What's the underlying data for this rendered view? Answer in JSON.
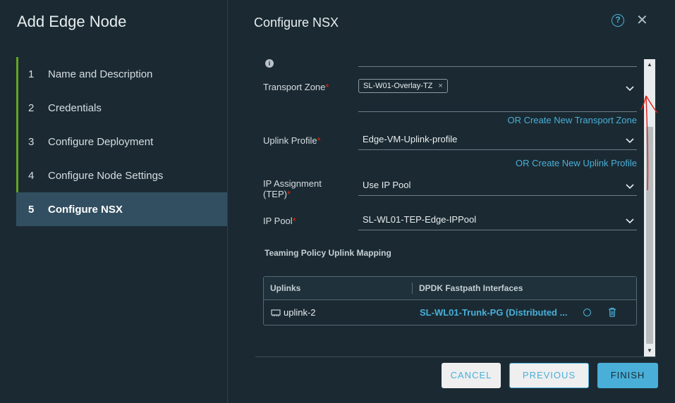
{
  "wizard": {
    "title": "Add Edge Node",
    "steps": [
      {
        "num": "1",
        "label": "Name and Description"
      },
      {
        "num": "2",
        "label": "Credentials"
      },
      {
        "num": "3",
        "label": "Configure Deployment"
      },
      {
        "num": "4",
        "label": "Configure Node Settings"
      },
      {
        "num": "5",
        "label": "Configure NSX"
      }
    ]
  },
  "page": {
    "title": "Configure NSX",
    "help_glyph": "?",
    "close_glyph": "✕"
  },
  "form": {
    "transport_zone": {
      "label": "Transport Zone",
      "chip": "SL-W01-Overlay-TZ",
      "chip_remove": "×",
      "create_link": "OR Create New Transport Zone"
    },
    "uplink_profile": {
      "label": "Uplink Profile",
      "value": "Edge-VM-Uplink-profile",
      "create_link": "OR Create New Uplink Profile"
    },
    "ip_assignment": {
      "label_line1": "IP Assignment",
      "label_line2": "(TEP)",
      "value": "Use IP Pool"
    },
    "ip_pool": {
      "label": "IP Pool",
      "value": "SL-WL01-TEP-Edge-IPPool"
    },
    "required_mark": "*"
  },
  "teaming": {
    "title": "Teaming Policy Uplink Mapping",
    "columns": [
      "Uplinks",
      "DPDK Fastpath Interfaces"
    ],
    "rows": [
      {
        "uplink": "uplink-2",
        "interface": "SL-WL01-Trunk-PG (Distributed ..."
      }
    ]
  },
  "footer": {
    "cancel": "CANCEL",
    "previous": "PREVIOUS",
    "finish": "FINISH"
  },
  "colors": {
    "background": "#1b2a32",
    "accent": "#49afd9",
    "active_step": "#324f61",
    "done_step": "#62a420",
    "required": "#e62700",
    "annotation": "#e0201b"
  }
}
